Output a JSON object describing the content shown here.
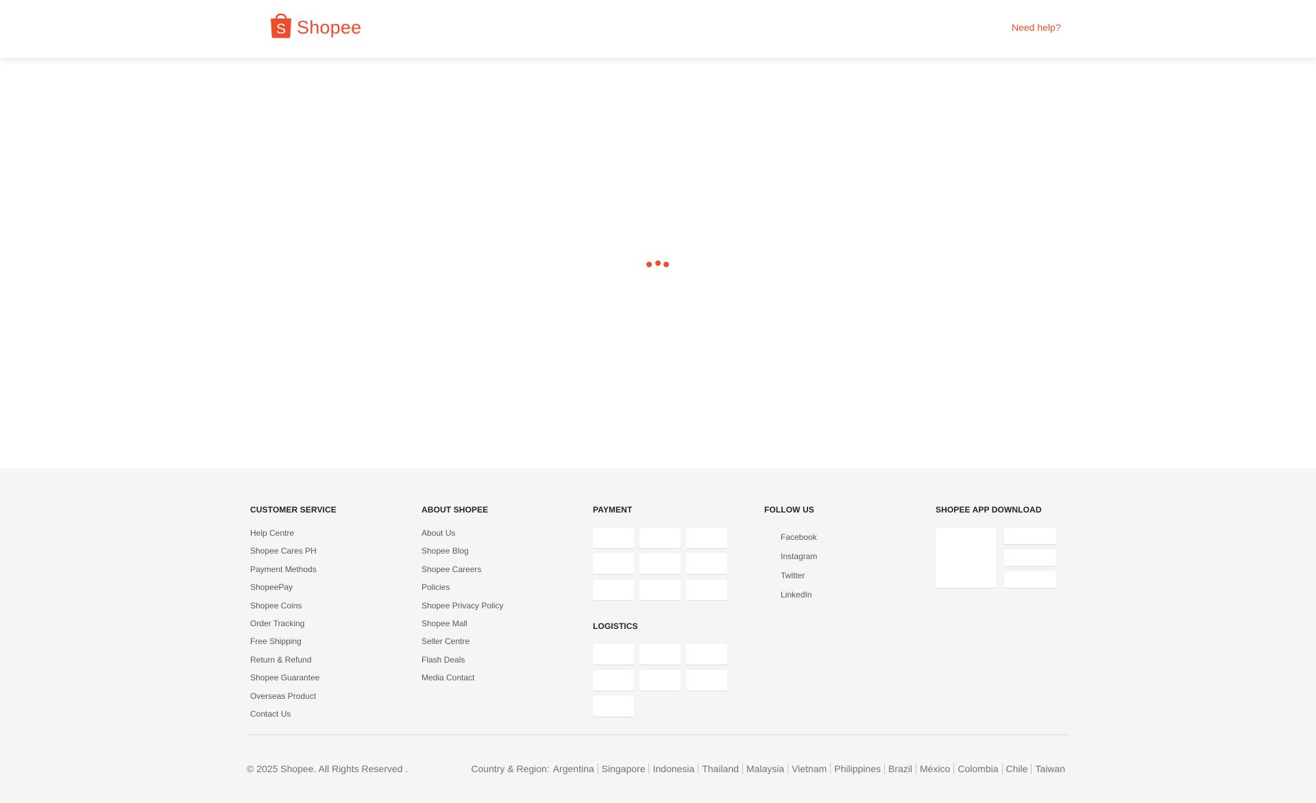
{
  "header": {
    "logo_text": "Shopee",
    "help_link": "Need help?"
  },
  "colors": {
    "brand": "#ee4d2d",
    "footer_bg": "#f5f5f5"
  },
  "footer": {
    "customer_service": {
      "title": "CUSTOMER SERVICE",
      "links": [
        "Help Centre",
        "Shopee Cares PH",
        "Payment Methods",
        "ShopeePay",
        "Shopee Coins",
        "Order Tracking",
        "Free Shipping",
        "Return & Refund",
        "Shopee Guarantee",
        "Overseas Product",
        "Contact Us"
      ]
    },
    "about": {
      "title": "ABOUT SHOPEE",
      "links": [
        "About Us",
        "Shopee Blog",
        "Shopee Careers",
        "Policies",
        "Shopee Privacy Policy",
        "Shopee Mall",
        "Seller Centre",
        "Flash Deals",
        "Media Contact"
      ]
    },
    "payment": {
      "title": "PAYMENT"
    },
    "logistics": {
      "title": "LOGISTICS"
    },
    "follow": {
      "title": "FOLLOW US",
      "items": [
        {
          "label": "Facebook",
          "icon": "facebook-icon"
        },
        {
          "label": "Instagram",
          "icon": "instagram-icon"
        },
        {
          "label": "Twitter",
          "icon": "twitter-icon"
        },
        {
          "label": "LinkedIn",
          "icon": "linkedin-icon"
        }
      ]
    },
    "app": {
      "title": "SHOPEE APP DOWNLOAD"
    },
    "copyright": "© 2025 Shopee. All Rights Reserved .",
    "region_label": "Country & Region:",
    "regions": [
      "Argentina",
      "Singapore",
      "Indonesia",
      "Thailand",
      "Malaysia",
      "Vietnam",
      "Philippines",
      "Brazil",
      "México",
      "Colombia",
      "Chile",
      "Taiwan"
    ]
  }
}
